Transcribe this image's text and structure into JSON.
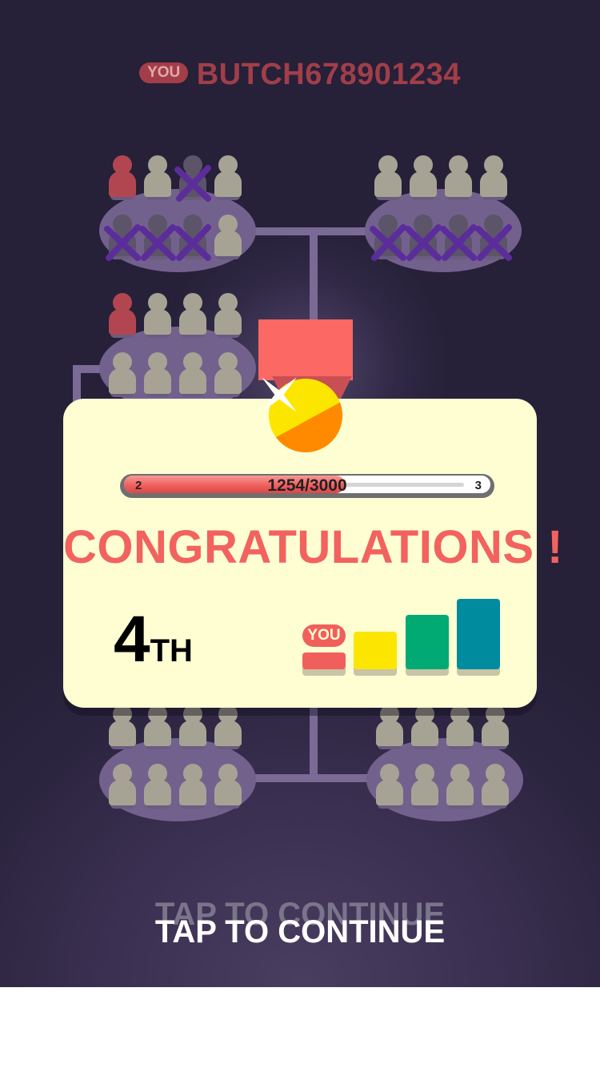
{
  "header": {
    "you_badge": "YOU",
    "player_name": "BUTCH678901234"
  },
  "result": {
    "progress": {
      "level_from": "2",
      "level_to": "3",
      "score_text": "1254/3000",
      "current": 1254,
      "max": 3000
    },
    "title": "CONGRATULATIONS !",
    "rank_number": "4",
    "rank_suffix": "TH",
    "podium_you_badge": "YOU"
  },
  "bracket": {
    "tables": [
      {
        "id": "top-left",
        "players": [
          "red",
          "gray",
          "elim",
          "gray",
          "elim",
          "elim",
          "elim",
          "gray"
        ]
      },
      {
        "id": "top-right",
        "players": [
          "gray",
          "gray",
          "gray",
          "gray",
          "elim",
          "elim",
          "elim",
          "elim"
        ]
      },
      {
        "id": "mid-left",
        "players": [
          "red",
          "gray",
          "gray",
          "gray",
          "gray",
          "gray",
          "gray",
          "gray"
        ]
      },
      {
        "id": "bottom-left",
        "players": [
          "gray",
          "gray",
          "gray",
          "gray",
          "gray",
          "gray",
          "gray",
          "gray"
        ]
      },
      {
        "id": "bottom-right",
        "players": [
          "gray",
          "gray",
          "gray",
          "gray",
          "gray",
          "gray",
          "gray",
          "gray"
        ]
      }
    ]
  },
  "colors": {
    "background": "#2c2540",
    "card": "#fffed3",
    "accent_red": "#f2625f",
    "podium": [
      "#f15f5d",
      "#fce600",
      "#00aa72",
      "#008b9e"
    ],
    "medal_yellow": "#fce600",
    "medal_orange": "#ff8a00",
    "eliminated_mark": "#5b2d9a"
  },
  "footer": {
    "tap_ghost": "TAP TO CONTINUE",
    "tap_label": "TAP TO CONTINUE"
  }
}
